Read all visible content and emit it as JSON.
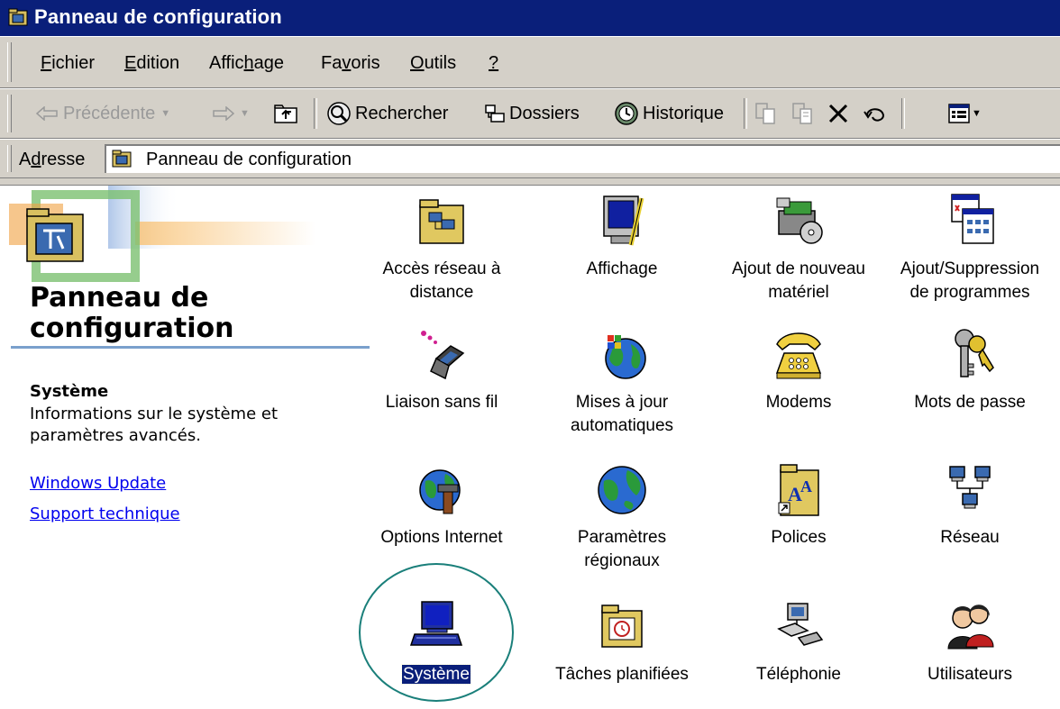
{
  "window": {
    "title": "Panneau de configuration"
  },
  "menu": {
    "items": [
      {
        "pre": "",
        "u": "F",
        "post": "ichier"
      },
      {
        "pre": "",
        "u": "E",
        "post": "dition"
      },
      {
        "pre": "Affic",
        "u": "h",
        "post": "age"
      },
      {
        "pre": "Fa",
        "u": "v",
        "post": "oris"
      },
      {
        "pre": "",
        "u": "O",
        "post": "utils"
      },
      {
        "pre": "",
        "u": "?",
        "post": ""
      }
    ]
  },
  "toolbar": {
    "back": "Précédente",
    "search": "Rechercher",
    "folders": "Dossiers",
    "history": "Historique"
  },
  "address": {
    "label_pre": "A",
    "label_u": "d",
    "label_post": "resse",
    "value": "Panneau de configuration"
  },
  "left_panel": {
    "title": "Panneau de configuration",
    "selected_name": "Système",
    "selected_description": "Informations sur le système et paramètres avancés.",
    "links": [
      "Windows Update",
      "Support technique"
    ]
  },
  "items": [
    {
      "label": "Accès réseau à distance",
      "icon": "dialup-folder-icon"
    },
    {
      "label": "Affichage",
      "icon": "display-icon"
    },
    {
      "label": "Ajout de nouveau matériel",
      "icon": "hardware-icon"
    },
    {
      "label": "Ajout/Suppression de programmes",
      "icon": "add-remove-icon"
    },
    {
      "label": "Liaison sans fil",
      "icon": "wireless-icon"
    },
    {
      "label": "Mises à jour automatiques",
      "icon": "update-globe-icon"
    },
    {
      "label": "Modems",
      "icon": "telephone-icon"
    },
    {
      "label": "Mots de passe",
      "icon": "keys-icon"
    },
    {
      "label": "Options Internet",
      "icon": "internet-globe-icon"
    },
    {
      "label": "Paramètres régionaux",
      "icon": "globe-icon"
    },
    {
      "label": "Polices",
      "icon": "fonts-folder-icon"
    },
    {
      "label": "Réseau",
      "icon": "network-icon"
    },
    {
      "label": "Système",
      "icon": "computer-icon",
      "selected": true
    },
    {
      "label": "Tâches planifiées",
      "icon": "scheduled-folder-icon"
    },
    {
      "label": "Téléphonie",
      "icon": "telephony-icon"
    },
    {
      "label": "Utilisateurs",
      "icon": "users-icon"
    }
  ]
}
